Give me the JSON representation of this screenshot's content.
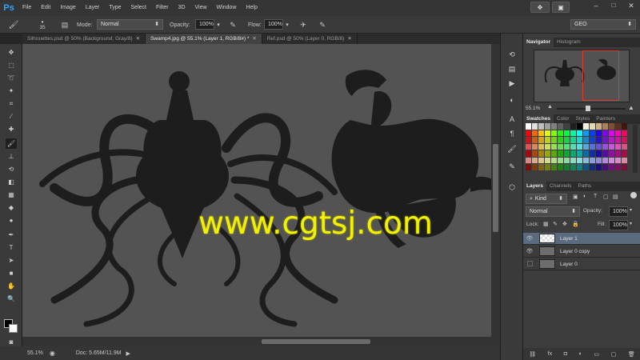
{
  "app": {
    "logo": "Ps"
  },
  "menu": [
    "File",
    "Edit",
    "Image",
    "Layer",
    "Type",
    "Select",
    "Filter",
    "3D",
    "View",
    "Window",
    "Help"
  ],
  "window_controls": {
    "minimize": "–",
    "maximize": "□",
    "close": "✕"
  },
  "options_bar": {
    "brush_size": "35",
    "mode_label": "Mode:",
    "mode_value": "Normal",
    "opacity_label": "Opacity:",
    "opacity_value": "100%",
    "flow_label": "Flow:",
    "flow_value": "100%",
    "workspace": "GEO"
  },
  "doc_tabs": [
    {
      "title": "Silhouettes.psd @ 50% (Background, Gray/8)",
      "close": "✕",
      "active": false
    },
    {
      "title": "Swamp4.jpg @ 55.1% (Layer 1, RGB/8#) *",
      "close": "✕",
      "active": true
    },
    {
      "title": "Ref.psd @ 50% (Layer 0, RGB/8)",
      "close": "✕",
      "active": false
    }
  ],
  "status": {
    "zoom": "55.1%",
    "doc": "Doc: 5.65M/11.9M"
  },
  "watermark": "www.cgtsj.com",
  "navigator": {
    "tab_active": "Navigator",
    "tab_other": "Histogram",
    "zoom": "55.1%"
  },
  "swatches_panel": {
    "tabs": [
      "Swatches",
      "Color",
      "Styles",
      "Painters"
    ]
  },
  "layers_panel": {
    "tabs": [
      "Layers",
      "Channels",
      "Paths"
    ],
    "kind_label": "Kind",
    "blend_mode": "Normal",
    "opacity_label": "Opacity:",
    "opacity_value": "100%",
    "lock_label": "Lock:",
    "fill_label": "Fill:",
    "fill_value": "100%",
    "layers": [
      {
        "name": "Layer 1",
        "visible": true,
        "selected": true
      },
      {
        "name": "Layer 0 copy",
        "visible": true,
        "selected": false
      },
      {
        "name": "Layer 0",
        "visible": false,
        "selected": false
      }
    ]
  },
  "colors": {
    "accent": "#31a8ff",
    "selection": "#5a6b80",
    "watermark": "#f3f000",
    "canvas": "#535353",
    "silhouette": "#1d1d1d"
  }
}
